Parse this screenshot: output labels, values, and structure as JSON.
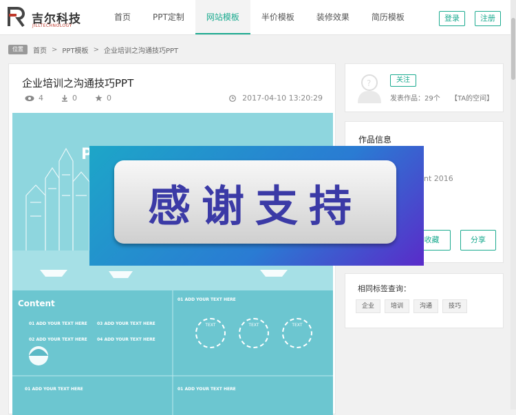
{
  "brand": {
    "name": "吉尔科技",
    "sub": "JILLTECHNOLOGY"
  },
  "nav": [
    "首页",
    "PPT定制",
    "网站模板",
    "半价模板",
    "装修效果",
    "简历模板"
  ],
  "auth": {
    "login": "登录",
    "register": "注册"
  },
  "breadcrumb": {
    "badge": "位置",
    "items": [
      "首页",
      "PPT模板",
      "企业培训之沟通技巧PPT"
    ],
    "sep": ">"
  },
  "article": {
    "title": "企业培训之沟通技巧PPT",
    "views": "4",
    "downloads": "0",
    "likes": "0",
    "date": "2017-04-10 13:20:29"
  },
  "preview": {
    "ppt_letter": "P",
    "content_title": "Content",
    "add1": "01 ADD YOUR TEXT HERE",
    "add2": "02 ADD YOUR TEXT HERE",
    "add3": "03 ADD YOUR TEXT HERE",
    "add4": "04 ADD YOUR TEXT HERE",
    "add_right": "01 ADD YOUR TEXT HERE",
    "add_bottom_left": "01 ADD YOUR TEXT HERE",
    "add_bottom_right": "01 ADD YOUR TEXT HERE",
    "circle": "TEXT"
  },
  "overlay": {
    "text": "感谢支持"
  },
  "author": {
    "follow": "关注",
    "works": "发表作品：29个",
    "space": "【TA的空间】"
  },
  "work_info": {
    "title": "作品信息",
    "software": "nt 2016"
  },
  "actions": {
    "collect": "收藏",
    "share": "分享"
  },
  "tags": {
    "title": "相同标签查询：",
    "items": [
      "企业",
      "培训",
      "沟通",
      "技巧"
    ]
  },
  "colors": {
    "accent": "#1aaa8f",
    "overlay_text": "#3b3aa6"
  }
}
